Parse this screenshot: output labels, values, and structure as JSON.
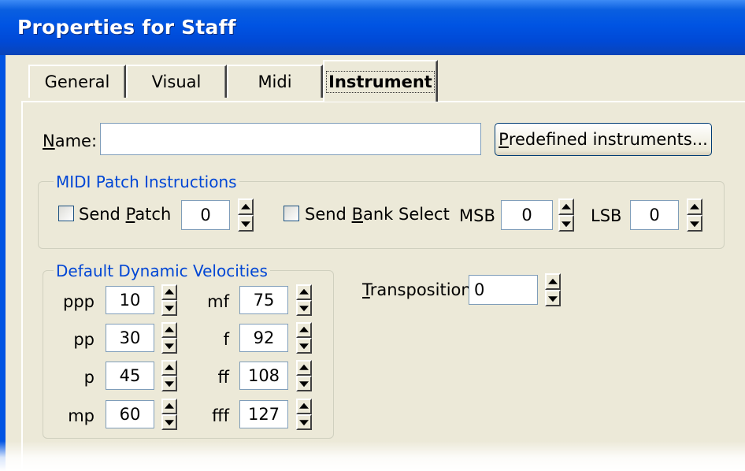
{
  "window": {
    "title": "Properties for Staff"
  },
  "tabs": [
    {
      "label": "General"
    },
    {
      "label": "Visual"
    },
    {
      "label": "Midi"
    },
    {
      "label": "Instrument"
    }
  ],
  "active_tab": "Instrument",
  "name_field": {
    "label_access": "N",
    "label_rest": "ame:",
    "value": ""
  },
  "predefined_button": {
    "label_access": "P",
    "label_rest": "redefined instruments..."
  },
  "midi_patch": {
    "title": "MIDI Patch Instructions",
    "send_patch": {
      "label_pre": "Send ",
      "label_access": "P",
      "label_rest": "atch",
      "checked": false,
      "value": "0"
    },
    "send_bank": {
      "label_pre": "Send ",
      "label_access": "B",
      "label_rest": "ank Select",
      "checked": false
    },
    "msb": {
      "label": "MSB",
      "value": "0"
    },
    "lsb": {
      "label": "LSB",
      "value": "0"
    }
  },
  "velocities": {
    "title": "Default Dynamic Velocities",
    "left": [
      {
        "label": "ppp",
        "value": "10"
      },
      {
        "label": "pp",
        "value": "30"
      },
      {
        "label": "p",
        "value": "45"
      },
      {
        "label": "mp",
        "value": "60"
      }
    ],
    "right": [
      {
        "label": "mf",
        "value": "75"
      },
      {
        "label": "f",
        "value": "92"
      },
      {
        "label": "ff",
        "value": "108"
      },
      {
        "label": "fff",
        "value": "127"
      }
    ]
  },
  "transposition": {
    "label_access": "T",
    "label_rest": "ransposition:",
    "value": "0"
  },
  "colors": {
    "titlebar": "#0054e3",
    "dialog": "#ece9d8",
    "groupbox_title": "#0046d5"
  }
}
